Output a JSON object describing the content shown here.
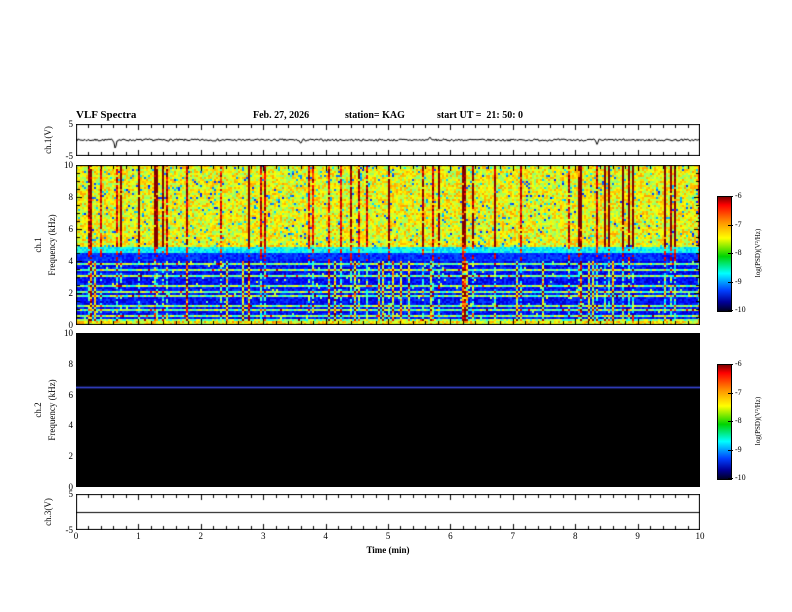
{
  "header": {
    "title": "VLF Spectra",
    "date": "Feb. 27, 2026",
    "station": "station= KAG",
    "start_ut": "start UT =  21: 50: 0"
  },
  "x_axis": {
    "label": "Time (min)",
    "ticks": [
      0,
      1,
      2,
      3,
      4,
      5,
      6,
      7,
      8,
      9,
      10
    ],
    "range": [
      0,
      10
    ]
  },
  "panels": {
    "ch1_wave": {
      "ylabel": "ch.1(V)",
      "ytick_top": "5",
      "ytick_bottom": "-5",
      "ylim": [
        -5,
        5
      ]
    },
    "ch1_spec": {
      "ylabel_channel": "ch.1",
      "ylabel_axis": "Frequency (kHz)",
      "yticks": [
        0,
        2,
        4,
        6,
        8,
        10
      ],
      "ylim": [
        0,
        10
      ]
    },
    "ch2_spec": {
      "ylabel_channel": "ch.2",
      "ylabel_axis": "Frequency (kHz)",
      "yticks": [
        0,
        2,
        4,
        6,
        8,
        10
      ],
      "ylim": [
        0,
        10
      ]
    },
    "ch3_wave": {
      "ylabel": "ch.3(V)",
      "ytick_top": "5",
      "ytick_bottom": "-5",
      "ylim": [
        -5,
        5
      ]
    }
  },
  "colorbars": [
    {
      "label": "log(PSD)(V²/Hz)",
      "ticks": [
        "-6",
        "-7",
        "-8",
        "-9",
        "-10"
      ],
      "range": [
        -10,
        -6
      ]
    },
    {
      "label": "log(PSD)(V²/Hz)",
      "ticks": [
        "-6",
        "-7",
        "-8",
        "-9",
        "-10"
      ],
      "range": [
        -10,
        -6
      ]
    }
  ],
  "colors": {
    "background": "#ffffff",
    "frame": "#000000",
    "ch2_line": "#3a46d8",
    "colormap_stops": [
      "#7f0000 0%",
      "#ff0000 7%",
      "#ff9100 22%",
      "#ffff00 36%",
      "#00d400 52%",
      "#00ffff 67%",
      "#0040ff 82%",
      "#000099 92%",
      "#000022 100%"
    ]
  },
  "chart_data": [
    {
      "type": "line",
      "title": "ch.1 voltage vs time",
      "xlabel": "Time (min)",
      "ylabel": "ch.1(V)",
      "xlim": [
        0,
        10
      ],
      "ylim": [
        -5,
        5
      ],
      "description": "Noisy trace close to 0 V with small impulsive spikes",
      "baseline": 0,
      "noise_amplitude_v": 0.35,
      "spikes": [
        {
          "x_min": 0.63,
          "amp_v": -3.0
        },
        {
          "x_min": 3.6,
          "amp_v": -1.2
        },
        {
          "x_min": 5.67,
          "amp_v": 1.0
        },
        {
          "x_min": 8.35,
          "amp_v": -1.4
        }
      ]
    },
    {
      "type": "heatmap",
      "title": "ch.1 VLF spectrogram",
      "xlabel": "Time (min)",
      "ylabel": "Frequency (kHz)",
      "xlim": [
        0,
        10
      ],
      "ylim": [
        0,
        10
      ],
      "zlabel": "log(PSD)(V²/Hz)",
      "zlim": [
        -10,
        -6
      ],
      "features": {
        "broadband_hiss_khz": [
          4.9,
          10
        ],
        "broadband_level_log_psd": -7.3,
        "impulsive_bursts": "dense vertical red streaks reaching -6 spanning 4-10 kHz throughout the 10 min record",
        "quiet_low_band_khz": [
          0,
          4.5
        ],
        "quiet_level_log_psd": -9.5,
        "horizontal_line_frequencies_khz": [
          0.35,
          0.6,
          0.9,
          1.2,
          1.5,
          1.8,
          2.1,
          2.45,
          2.75,
          3.1,
          3.45,
          3.8
        ],
        "bottom_edge_line_khz": 0.15
      },
      "render_seed": 42
    },
    {
      "type": "heatmap",
      "title": "ch.2 VLF spectrogram",
      "xlabel": "Time (min)",
      "ylabel": "Frequency (kHz)",
      "xlim": [
        0,
        10
      ],
      "ylim": [
        0,
        10
      ],
      "zlabel": "log(PSD)(V²/Hz)",
      "zlim": [
        -10,
        -6
      ],
      "features": {
        "background_level": "below -10 (black, no signal)",
        "horizontal_line_khz": 6.5,
        "line_color": "#3a46d8"
      }
    },
    {
      "type": "line",
      "title": "ch.3 voltage vs time",
      "xlabel": "Time (min)",
      "ylabel": "ch.3(V)",
      "xlim": [
        0,
        10
      ],
      "ylim": [
        -5,
        5
      ],
      "constant_value_v": 0
    }
  ]
}
